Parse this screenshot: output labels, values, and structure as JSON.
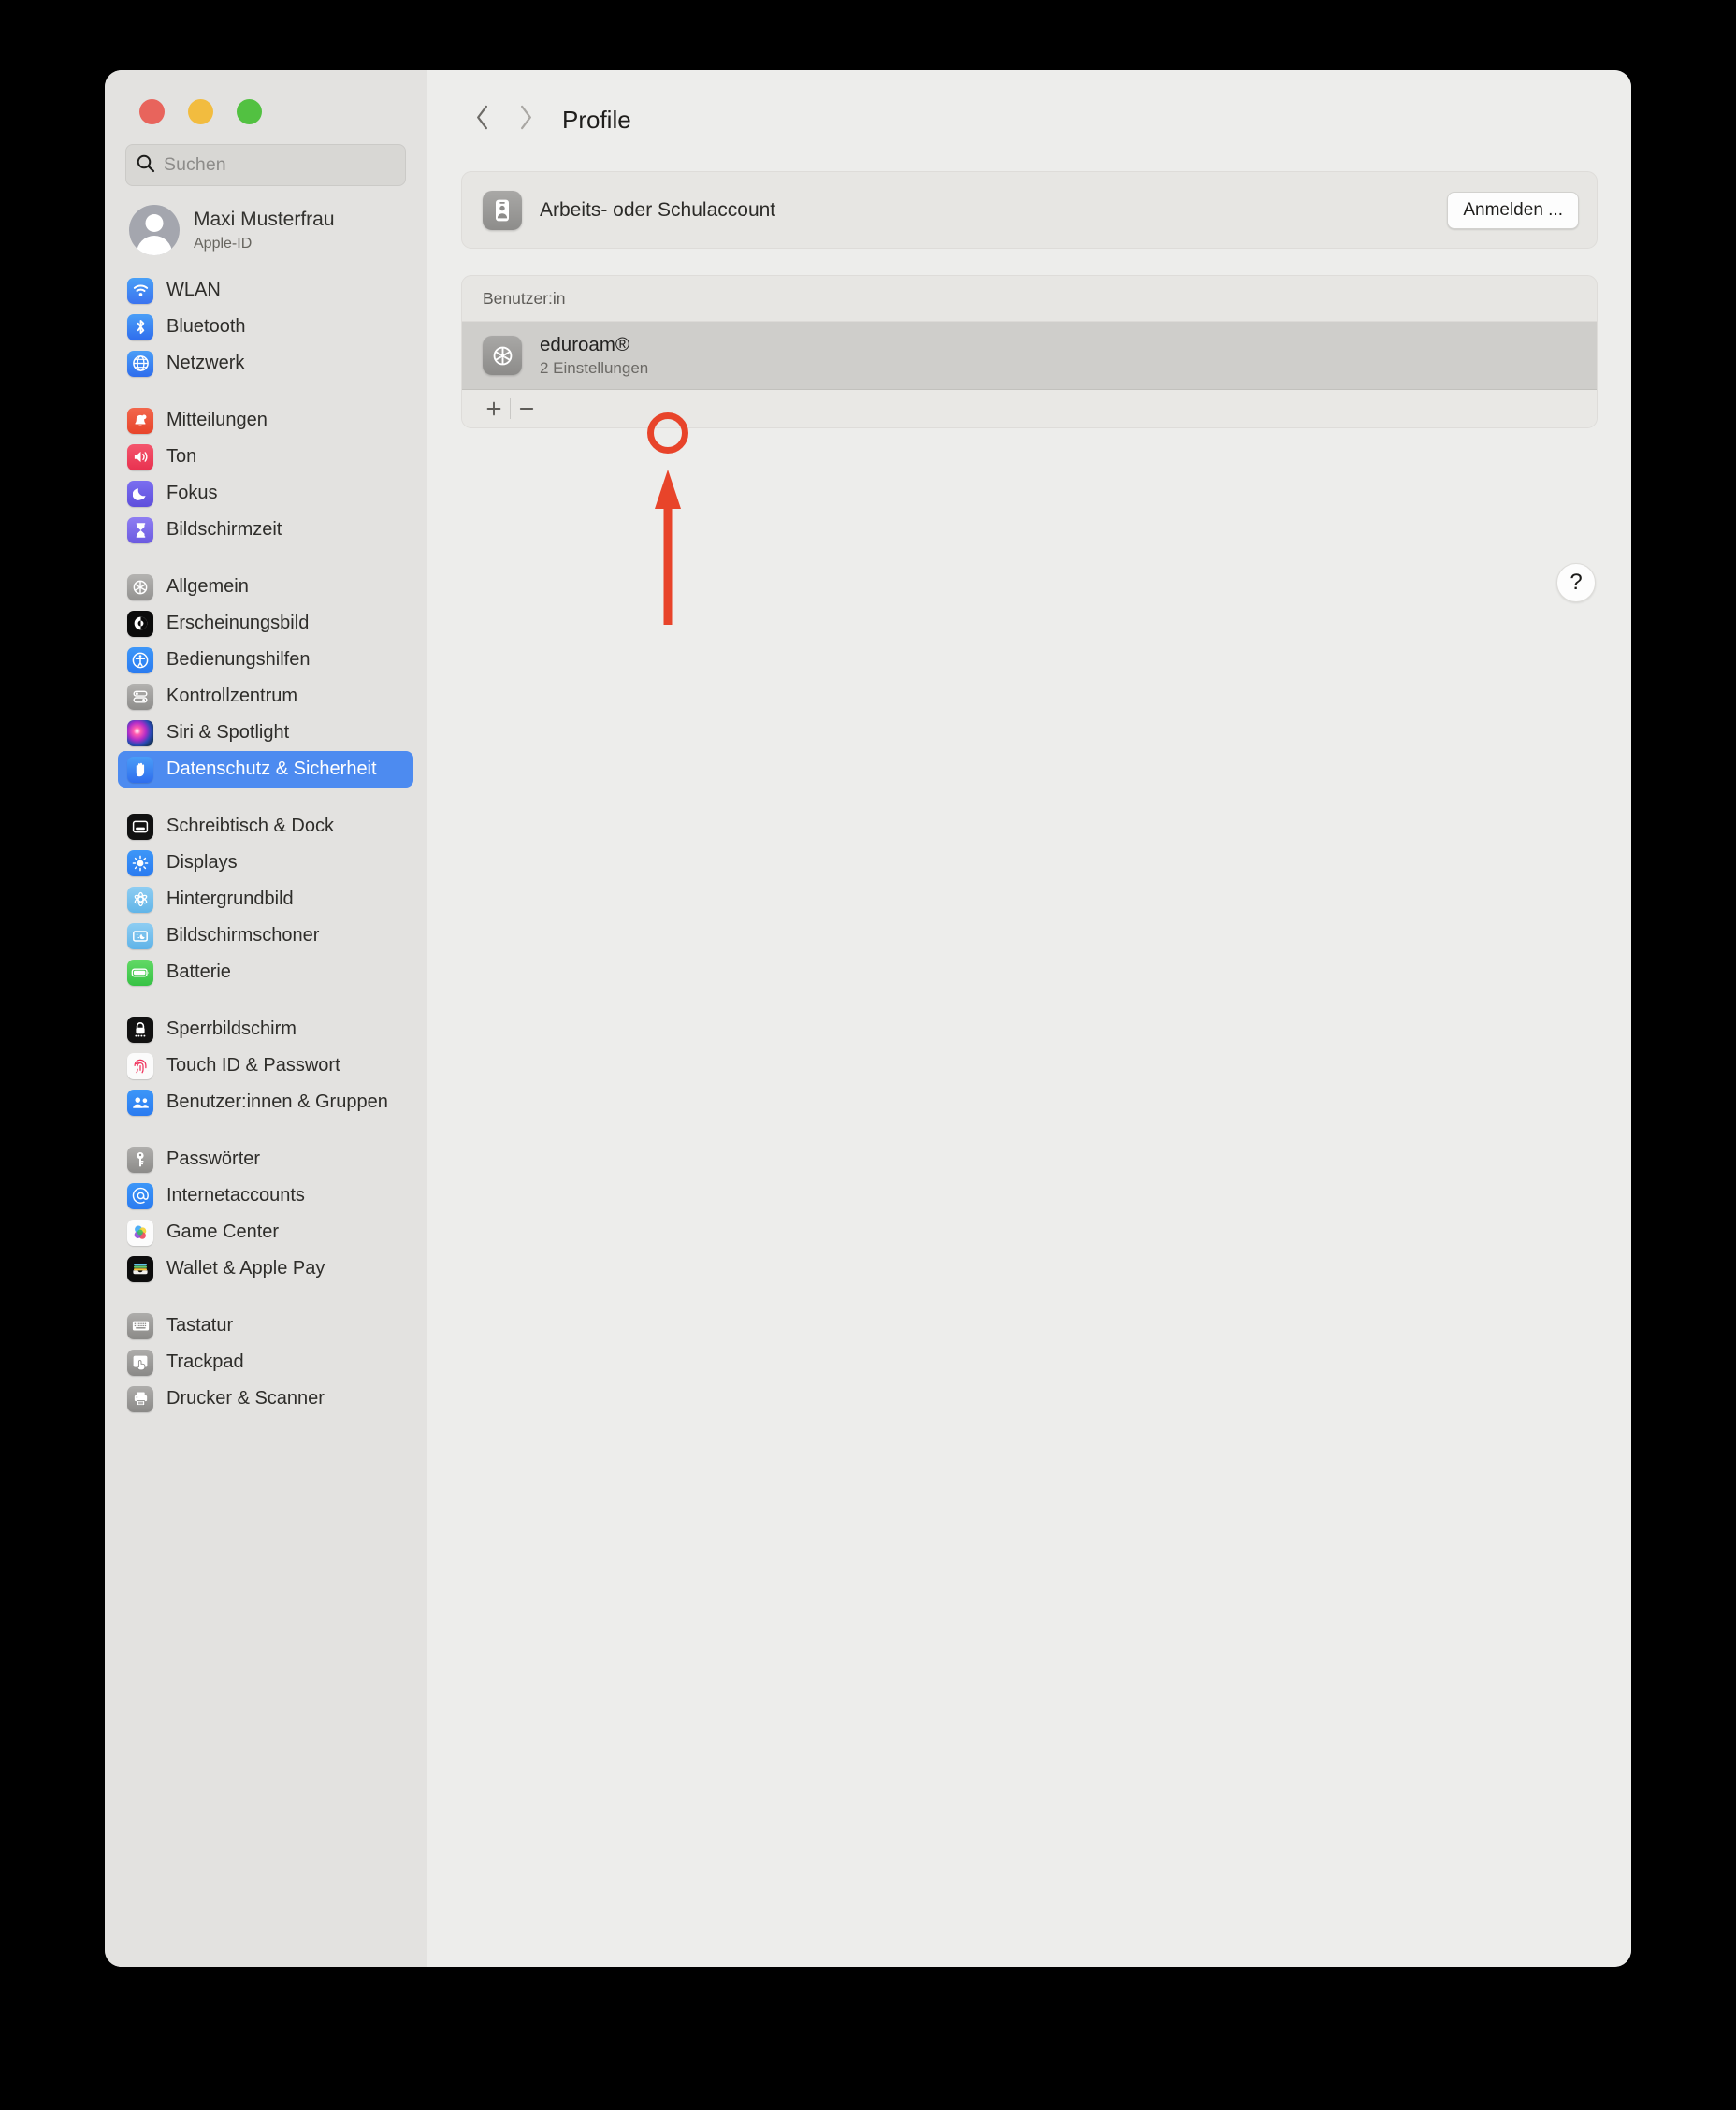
{
  "window": {
    "traffic_lights": [
      "close",
      "minimize",
      "zoom"
    ]
  },
  "sidebar": {
    "search": {
      "placeholder": "Suchen",
      "value": "",
      "icon": "search-icon"
    },
    "account": {
      "name": "Maxi Musterfrau",
      "subtitle": "Apple-ID",
      "avatar": "person-avatar"
    },
    "groups": [
      {
        "items": [
          {
            "label": "WLAN",
            "icon": "wifi-icon"
          },
          {
            "label": "Bluetooth",
            "icon": "bluetooth-icon"
          },
          {
            "label": "Netzwerk",
            "icon": "globe-icon"
          }
        ]
      },
      {
        "items": [
          {
            "label": "Mitteilungen",
            "icon": "bell-icon"
          },
          {
            "label": "Ton",
            "icon": "speaker-icon"
          },
          {
            "label": "Fokus",
            "icon": "moon-icon"
          },
          {
            "label": "Bildschirmzeit",
            "icon": "hourglass-icon"
          }
        ]
      },
      {
        "items": [
          {
            "label": "Allgemein",
            "icon": "gear-icon"
          },
          {
            "label": "Erscheinungsbild",
            "icon": "appearance-icon"
          },
          {
            "label": "Bedienungshilfen",
            "icon": "accessibility-icon"
          },
          {
            "label": "Kontrollzentrum",
            "icon": "control-center-icon"
          },
          {
            "label": "Siri & Spotlight",
            "icon": "siri-icon"
          },
          {
            "label": "Datenschutz & Sicherheit",
            "icon": "hand-icon",
            "selected": true
          }
        ]
      },
      {
        "items": [
          {
            "label": "Schreibtisch & Dock",
            "icon": "desktop-dock-icon"
          },
          {
            "label": "Displays",
            "icon": "brightness-icon"
          },
          {
            "label": "Hintergrundbild",
            "icon": "wallpaper-icon"
          },
          {
            "label": "Bildschirmschoner",
            "icon": "screensaver-icon"
          },
          {
            "label": "Batterie",
            "icon": "battery-icon"
          }
        ]
      },
      {
        "items": [
          {
            "label": "Sperrbildschirm",
            "icon": "lock-icon"
          },
          {
            "label": "Touch ID & Passwort",
            "icon": "fingerprint-icon"
          },
          {
            "label": "Benutzer:innen & Gruppen",
            "icon": "users-icon"
          }
        ]
      },
      {
        "items": [
          {
            "label": "Passwörter",
            "icon": "key-icon"
          },
          {
            "label": "Internetaccounts",
            "icon": "at-icon"
          },
          {
            "label": "Game Center",
            "icon": "game-center-icon"
          },
          {
            "label": "Wallet & Apple Pay",
            "icon": "wallet-icon"
          }
        ]
      },
      {
        "items": [
          {
            "label": "Tastatur",
            "icon": "keyboard-icon"
          },
          {
            "label": "Trackpad",
            "icon": "trackpad-icon"
          },
          {
            "label": "Drucker & Scanner",
            "icon": "printer-icon"
          }
        ]
      }
    ]
  },
  "main": {
    "nav": {
      "back_icon": "chevron-left-icon",
      "forward_icon": "chevron-right-icon"
    },
    "title": "Profile",
    "account_row": {
      "icon": "id-badge-icon",
      "label": "Arbeits- oder Schulaccount",
      "button_label": "Anmelden ..."
    },
    "profiles_section": {
      "header": "Benutzer:in",
      "rows": [
        {
          "icon": "gear-icon",
          "name": "eduroam®",
          "detail": "2 Einstellungen",
          "selected": true
        }
      ],
      "tools": {
        "add_label": "+",
        "remove_label": "−"
      }
    },
    "help_button": {
      "label": "?"
    }
  },
  "annotation": {
    "color": "#e8442a",
    "highlight_target": "remove-profile-button",
    "shapes": [
      "circle",
      "arrow-up"
    ]
  }
}
